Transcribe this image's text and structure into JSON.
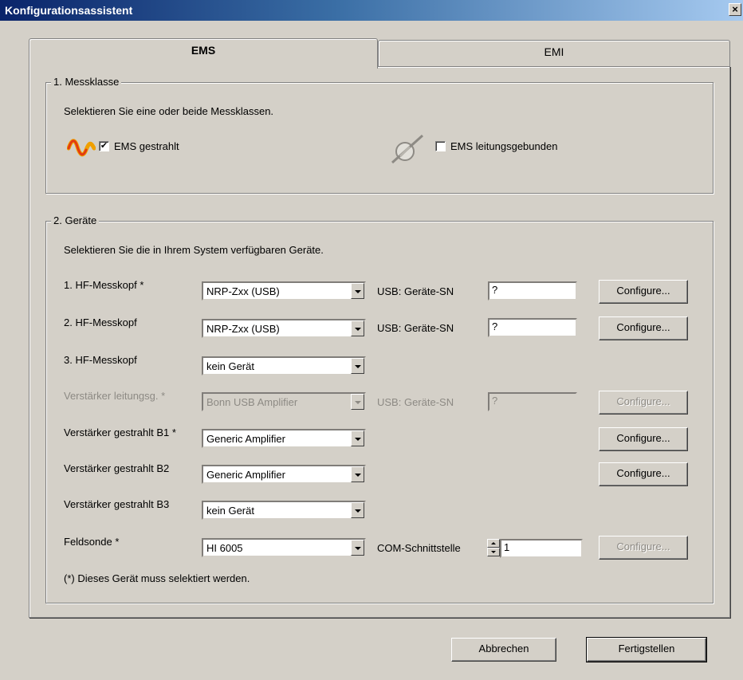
{
  "window": {
    "title": "Konfigurationsassistent",
    "close_label": "×"
  },
  "tabs": [
    {
      "label": "EMS",
      "active": true
    },
    {
      "label": "EMI",
      "active": false
    }
  ],
  "group1": {
    "legend": "1. Messklasse",
    "instruction": "Selektieren Sie eine oder beide Messklassen.",
    "options": [
      {
        "label": "EMS gestrahlt",
        "checked": true,
        "check_mark": "✔",
        "icon": "wave-icon"
      },
      {
        "label": "EMS leitungsgebunden",
        "checked": false,
        "check_mark": "",
        "icon": "cable-icon"
      }
    ]
  },
  "group2": {
    "legend": "2. Geräte",
    "instruction": "Selektieren Sie die in Ihrem System verfügbaren Geräte.",
    "rows": [
      {
        "label": "1. HF-Messkopf *",
        "device": "NRP-Zxx (USB)",
        "extra_label": "USB: Geräte-SN",
        "extra_value": "?",
        "button": "Configure...",
        "disabled": false
      },
      {
        "label": "2. HF-Messkopf",
        "device": "NRP-Zxx (USB)",
        "extra_label": "USB: Geräte-SN",
        "extra_value": "?",
        "button": "Configure...",
        "disabled": false
      },
      {
        "label": "3. HF-Messkopf",
        "device": "kein Gerät",
        "disabled": false
      },
      {
        "label": "Verstärker leitungsg. *",
        "device": "Bonn USB Amplifier",
        "extra_label": "USB: Geräte-SN",
        "extra_value": "?",
        "button": "Configure...",
        "disabled": true
      },
      {
        "label": "Verstärker gestrahlt B1 *",
        "device": "Generic Amplifier",
        "button": "Configure...",
        "disabled": false
      },
      {
        "label": "Verstärker gestrahlt B2",
        "device": "Generic Amplifier",
        "button": "Configure...",
        "disabled": false
      },
      {
        "label": "Verstärker gestrahlt B3",
        "device": "kein Gerät",
        "disabled": false
      },
      {
        "label": "Feldsonde *",
        "device": "HI 6005",
        "extra_label": "COM-Schnittstelle",
        "extra_value": "1",
        "button": "Configure...",
        "button_disabled": true,
        "disabled": false
      }
    ],
    "footnote": "(*) Dieses Gerät muss selektiert werden."
  },
  "footer": {
    "cancel_label": "Abbrechen",
    "finish_label": "Fertigstellen"
  }
}
